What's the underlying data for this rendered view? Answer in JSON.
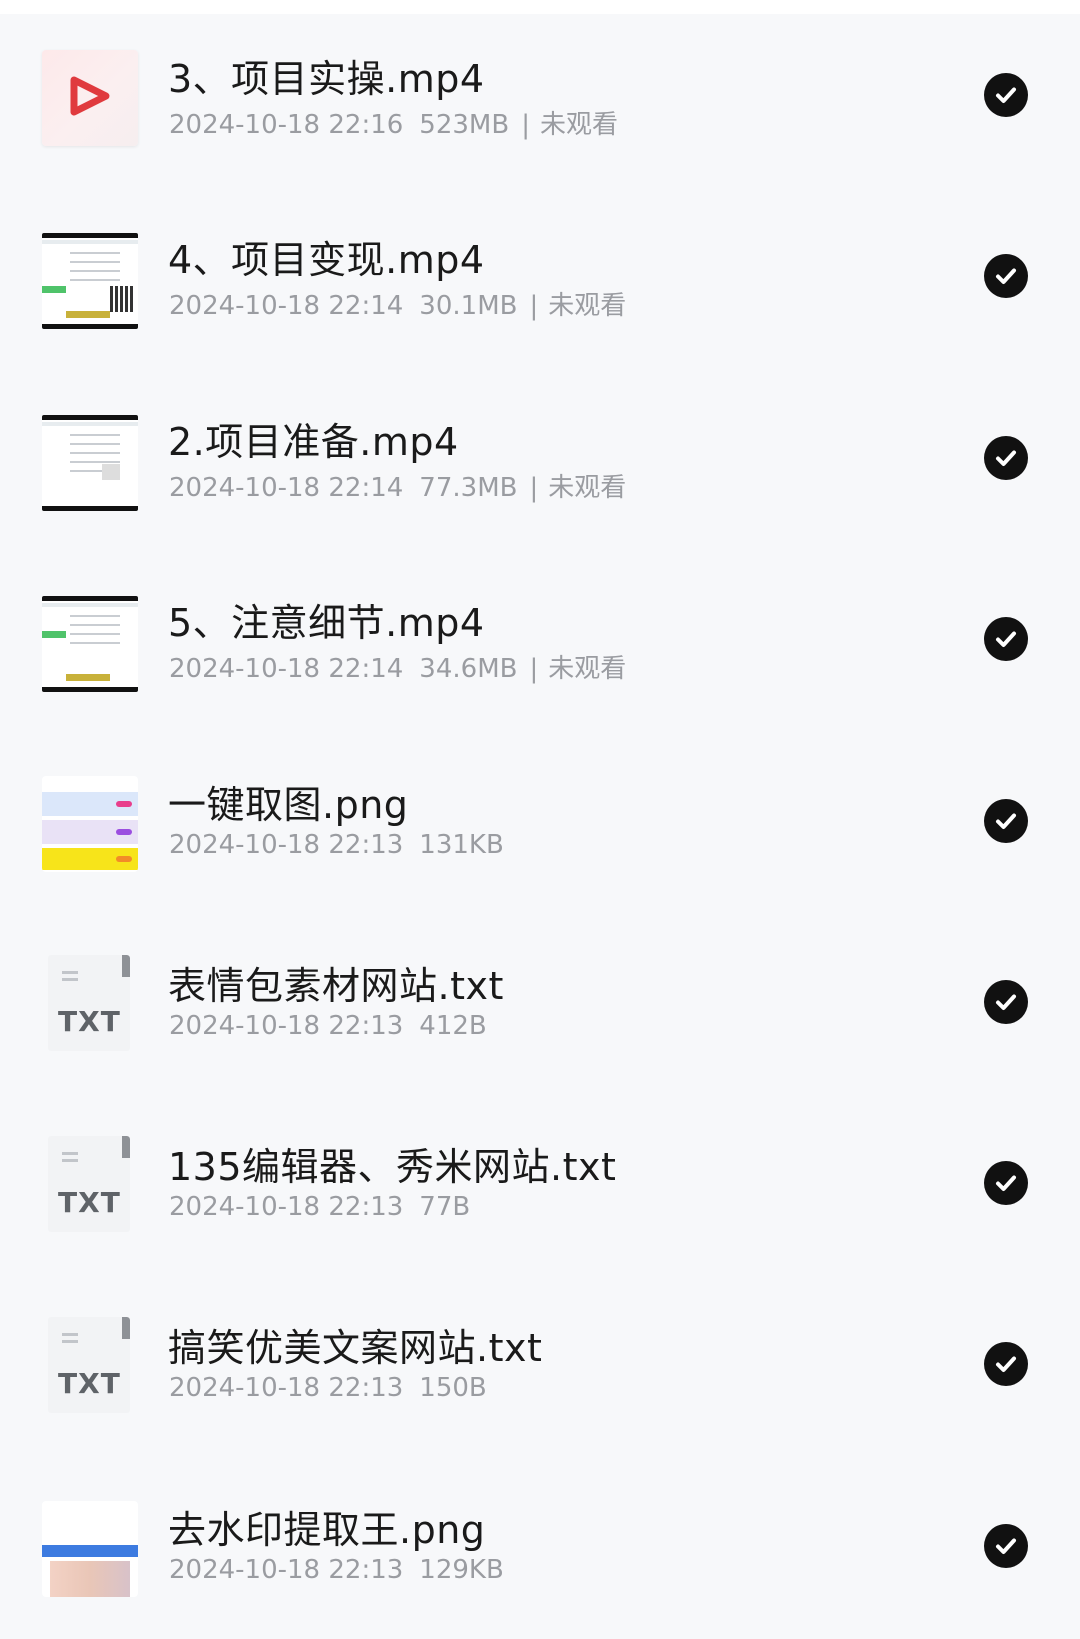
{
  "files": [
    {
      "name": "3、项目实操.mp4",
      "date": "2024-10-18 22:16",
      "size": "523MB",
      "status": "未观看",
      "type": "video-play"
    },
    {
      "name": "4、项目变现.mp4",
      "date": "2024-10-18 22:14",
      "size": "30.1MB",
      "status": "未观看",
      "type": "video-screen"
    },
    {
      "name": "2.项目准备.mp4",
      "date": "2024-10-18 22:14",
      "size": "77.3MB",
      "status": "未观看",
      "type": "video-screen"
    },
    {
      "name": "5、注意细节.mp4",
      "date": "2024-10-18 22:14",
      "size": "34.6MB",
      "status": "未观看",
      "type": "video-screen"
    },
    {
      "name": "一键取图.png",
      "date": "2024-10-18 22:13",
      "size": "131KB",
      "status": "",
      "type": "image-cards"
    },
    {
      "name": "表情包素材网站.txt",
      "date": "2024-10-18 22:13",
      "size": "412B",
      "status": "",
      "type": "txt"
    },
    {
      "name": "135编辑器、秀米网站.txt",
      "date": "2024-10-18 22:13",
      "size": "77B",
      "status": "",
      "type": "txt"
    },
    {
      "name": "搞笑优美文案网站.txt",
      "date": "2024-10-18 22:13",
      "size": "150B",
      "status": "",
      "type": "txt"
    },
    {
      "name": "去水印提取王.png",
      "date": "2024-10-18 22:13",
      "size": "129KB",
      "status": "",
      "type": "image-photo"
    }
  ],
  "txt_label": "TXT",
  "icons": {
    "check": "check-circle-icon",
    "play": "play-icon"
  },
  "colors": {
    "check_bg": "#111111",
    "play_red": "#e03a3e",
    "meta_text": "#9a9ca1"
  }
}
